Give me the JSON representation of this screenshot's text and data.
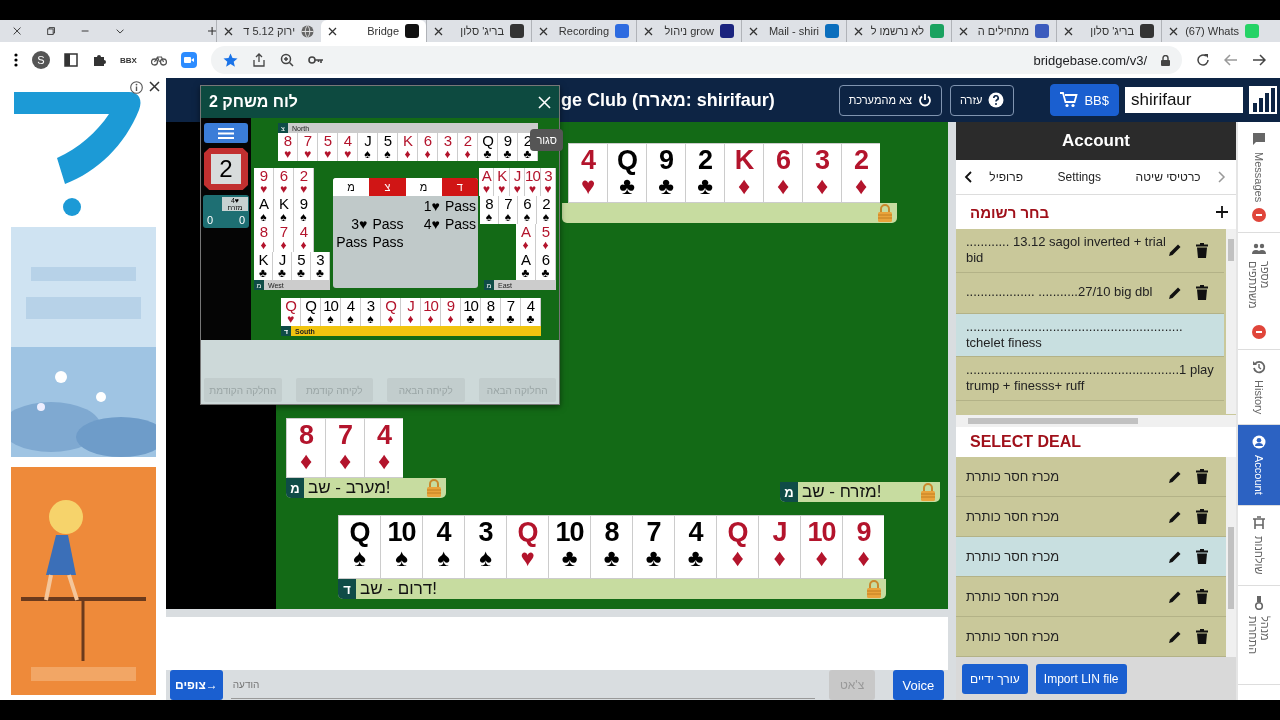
{
  "browser": {
    "tabs": [
      {
        "title": "(67) Whats",
        "selected": false
      },
      {
        "title": "בריג' סלון",
        "selected": false
      },
      {
        "title": "מתחילים ה",
        "selected": false
      },
      {
        "title": "לא נרשמו ל",
        "selected": false
      },
      {
        "title": "Mail - shiri",
        "selected": false
      },
      {
        "title": "ניהול grow",
        "selected": false
      },
      {
        "title": "Recording",
        "selected": false
      },
      {
        "title": "בריג' סלון",
        "selected": false
      },
      {
        "title": "Bridge",
        "selected": true
      },
      {
        "title": "ירוק 5.12 ד",
        "selected": false
      }
    ],
    "profile_initial": "S",
    "extension_label": "BBX",
    "url": "bridgebase.com/v3/"
  },
  "header": {
    "title": "ge Club (מארח: shirifaur)",
    "buttons": [
      {
        "kind": "cart",
        "label": "BB$"
      },
      {
        "kind": "help",
        "label": "עזרה"
      },
      {
        "kind": "logout",
        "label": "צא מהמערכת"
      }
    ],
    "user": "shirifaur"
  },
  "table": {
    "hands": [
      {
        "kind": "north",
        "suits": [
          {
            "suit": "♦",
            "color": "#b3142c",
            "cards": [
              "2",
              "3",
              "6",
              "K"
            ]
          },
          {
            "suit": "♣",
            "color": "#000000",
            "cards": [
              "2",
              "9",
              "Q"
            ]
          },
          {
            "suit": "♥",
            "color": "#b3142c",
            "cards": [
              "4"
            ]
          }
        ]
      },
      {
        "kind": "east",
        "badge": "מ",
        "label": "מזרח - שב!"
      },
      {
        "kind": "west",
        "suits": [
          {
            "suit": "♦",
            "color": "#b3142c",
            "cards": [
              "4",
              "7",
              "8"
            ]
          }
        ],
        "badge": "מ",
        "label": "מערב - שב!"
      },
      {
        "kind": "south",
        "suits": [
          {
            "suit": "♦",
            "color": "#b3142c",
            "cards": [
              "9",
              "10",
              "J",
              "Q"
            ]
          },
          {
            "suit": "♣",
            "color": "#000000",
            "cards": [
              "4",
              "7",
              "8",
              "10"
            ]
          },
          {
            "suit": "♥",
            "color": "#b3142c",
            "cards": [
              "Q"
            ]
          },
          {
            "suit": "♠",
            "color": "#000000",
            "cards": [
              "3",
              "4",
              "10",
              "Q"
            ]
          }
        ],
        "badge": "ד",
        "label": "דרום - שב!"
      }
    ]
  },
  "board_window": {
    "title": "לוח משחק 2",
    "close_tooltip": "סגור",
    "board_number": "2",
    "contract": "4♥",
    "declarer": "מזרח",
    "scores": [
      "0",
      "0"
    ],
    "hands": [
      {
        "kind": "north",
        "label": "North",
        "badge": "צ",
        "highlighted": false,
        "suits": [
          {
            "suit": "♣",
            "color": "#000000",
            "cards": [
              "2",
              "9",
              "Q"
            ]
          },
          {
            "suit": "♦",
            "color": "#b3142c",
            "cards": [
              "2",
              "3",
              "6",
              "K"
            ]
          },
          {
            "suit": "♠",
            "color": "#000000",
            "cards": [
              "5",
              "J"
            ]
          },
          {
            "suit": "♥",
            "color": "#b3142c",
            "cards": [
              "4",
              "5",
              "7",
              "8"
            ]
          }
        ]
      },
      {
        "kind": "east",
        "label": "East",
        "badge": "מ",
        "highlighted": false,
        "suits": [
          {
            "suit": "♥",
            "color": "#b3142c",
            "cards": [
              "3",
              "10",
              "J",
              "K",
              "A"
            ]
          },
          {
            "suit": "♠",
            "color": "#000000",
            "cards": [
              "2",
              "6",
              "7",
              "8"
            ]
          },
          {
            "suit": "♦",
            "color": "#b3142c",
            "cards": [
              "5",
              "A"
            ]
          },
          {
            "suit": "♣",
            "color": "#000000",
            "cards": [
              "6",
              "A"
            ]
          }
        ]
      },
      {
        "kind": "west",
        "label": "West",
        "badge": "מ",
        "highlighted": false,
        "suits": [
          {
            "suit": "♥",
            "color": "#b3142c",
            "cards": [
              "2",
              "6",
              "9"
            ]
          },
          {
            "suit": "♠",
            "color": "#000000",
            "cards": [
              "9",
              "K",
              "A"
            ]
          },
          {
            "suit": "♦",
            "color": "#b3142c",
            "cards": [
              "4",
              "7",
              "8"
            ]
          },
          {
            "suit": "♣",
            "color": "#000000",
            "cards": [
              "3",
              "5",
              "J",
              "K"
            ]
          }
        ]
      },
      {
        "kind": "south",
        "label": "South",
        "badge": "ד",
        "highlighted": true,
        "suits": [
          {
            "suit": "♣",
            "color": "#000000",
            "cards": [
              "4",
              "7",
              "8",
              "10"
            ]
          },
          {
            "suit": "♦",
            "color": "#b3142c",
            "cards": [
              "9",
              "10",
              "J",
              "Q"
            ]
          },
          {
            "suit": "♠",
            "color": "#000000",
            "cards": [
              "3",
              "4",
              "10",
              "Q"
            ]
          },
          {
            "suit": "♥",
            "color": "#b3142c",
            "cards": [
              "Q"
            ]
          }
        ]
      }
    ],
    "bidding": {
      "columns": [
        {
          "label": "ד",
          "vulnerable": true
        },
        {
          "label": "מ",
          "vulnerable": false
        },
        {
          "label": "צ",
          "vulnerable": true
        },
        {
          "label": "מ",
          "vulnerable": false
        }
      ],
      "rounds": [
        {
          "calls": [
            {
              "kind": "call",
              "text": "Pass"
            },
            {
              "kind": "call",
              "text": "1♥"
            }
          ]
        },
        {
          "calls": [
            {
              "kind": "call",
              "text": "Pass"
            },
            {
              "kind": "call",
              "text": "4♥"
            },
            {
              "kind": "call",
              "text": "Pass"
            },
            {
              "kind": "call",
              "text": "3♥"
            }
          ]
        },
        {
          "calls": [
            {
              "kind": "empty"
            },
            {
              "kind": "empty"
            },
            {
              "kind": "call",
              "text": "Pass"
            },
            {
              "kind": "call",
              "text": "Pass"
            }
          ]
        }
      ]
    },
    "nav_buttons": [
      {
        "label": "החלוקה הבאה",
        "disabled": true
      },
      {
        "label": "לקיחה הבאה",
        "disabled": true
      },
      {
        "label": "לקיחה קודמת",
        "disabled": true
      },
      {
        "label": "החלקה הקודמת",
        "disabled": true
      }
    ]
  },
  "chat": {
    "spectators_button": "צופים→",
    "placeholder": "הודעה",
    "chat_button": {
      "label": "צ'אט",
      "disabled": true
    },
    "voice_button": "Voice"
  },
  "side_panel": {
    "title": "Account",
    "tabs": [
      {
        "label": "כרטיסי שיטה",
        "selected": false
      },
      {
        "label": "Settings",
        "selected": false
      },
      {
        "label": "פרופיל",
        "selected": false
      }
    ],
    "records": {
      "title": "בחר רשומה",
      "items": [
        {
          "text": "............ 13.12 sagol inverted + trial bid",
          "selected": false,
          "editable": true
        },
        {
          "text": "................... ...........27/10 big dbl",
          "selected": false,
          "editable": true
        },
        {
          "text": "............................................................ tchelet finess",
          "selected": true,
          "editable": false
        },
        {
          "text": "...........................................................1 play trump + finesss+ ruff",
          "selected": false,
          "editable": false
        }
      ]
    },
    "deals": {
      "title": "SELECT DEAL",
      "items": [
        {
          "text": "מכרז חסר כותרת",
          "selected": false
        },
        {
          "text": "מכרז חסר כותרת",
          "selected": false
        },
        {
          "text": "מכרז חסר כותרת",
          "selected": true
        },
        {
          "text": "מכרז חסר כותרת",
          "selected": false
        },
        {
          "text": "מכרז חסר כותרת",
          "selected": false
        }
      ]
    },
    "buttons": [
      "Import LIN file",
      "עורך ידיים"
    ]
  },
  "side_tabs": [
    {
      "kind": "messages",
      "label": "Messages",
      "selected": false,
      "badge": true
    },
    {
      "kind": "people",
      "label": "מספר משתתפים",
      "selected": false,
      "badge": true
    },
    {
      "kind": "history",
      "label": "History",
      "selected": false,
      "badge": false
    },
    {
      "kind": "account",
      "label": "Account",
      "selected": true,
      "badge": false
    },
    {
      "kind": "tables",
      "label": "שולחנות",
      "selected": false,
      "badge": false
    },
    {
      "kind": "director",
      "label": "מנהל התחרות",
      "selected": false,
      "badge": false
    }
  ]
}
